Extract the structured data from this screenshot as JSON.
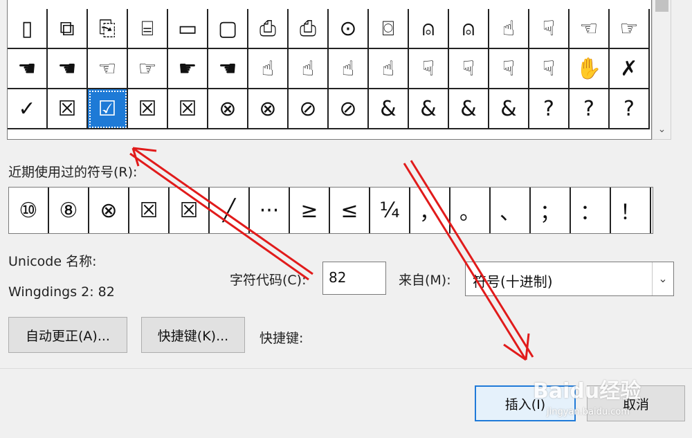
{
  "symbol_grid": {
    "rows": [
      [
        "▯",
        "⧉",
        "⎘",
        "⌸",
        "▭",
        "▢",
        "⎙",
        "⎙",
        "⊙",
        "⌼",
        "⍝",
        "⍝",
        "☝",
        "☟",
        "☜",
        "☞"
      ],
      [
        "☚",
        "☚",
        "☜",
        "☞",
        "☛",
        "☚",
        "☝",
        "☝",
        "☝",
        "☝",
        "☟",
        "☟",
        "☟",
        "☟",
        "✋",
        "✗"
      ],
      [
        "✓",
        "☒",
        "☑",
        "☒",
        "☒",
        "⊗",
        "⊗",
        "⊘",
        "⊘",
        "&",
        "&",
        "&",
        "&",
        "?",
        "?",
        "?"
      ]
    ],
    "selected": {
      "row": 2,
      "col": 2
    }
  },
  "recent_label": "近期使用过的符号(R):",
  "recent_symbols": [
    "⑩",
    "⑧",
    "⊗",
    "☒",
    "☒",
    "╱",
    "···",
    "≥",
    "≤",
    "¼",
    "，",
    "。",
    "、",
    "；",
    "：",
    "！"
  ],
  "unicode_name_label": "Unicode 名称:",
  "font_code": "Wingdings 2: 82",
  "char_code_label": "字符代码(C):",
  "char_code_value": "82",
  "from_label": "来自(M):",
  "from_value": "符号(十进制)",
  "autocorrect_button": "自动更正(A)...",
  "shortcut_key_button": "快捷键(K)...",
  "shortcut_label": "快捷键:",
  "insert_button": "插入(I)",
  "cancel_button": "取消",
  "watermark": {
    "main": "Baidu经验",
    "sub": "jingyan.baidu.com"
  },
  "colors": {
    "selection": "#1e7ad6",
    "annotation_arrow": "#e11b1b"
  }
}
